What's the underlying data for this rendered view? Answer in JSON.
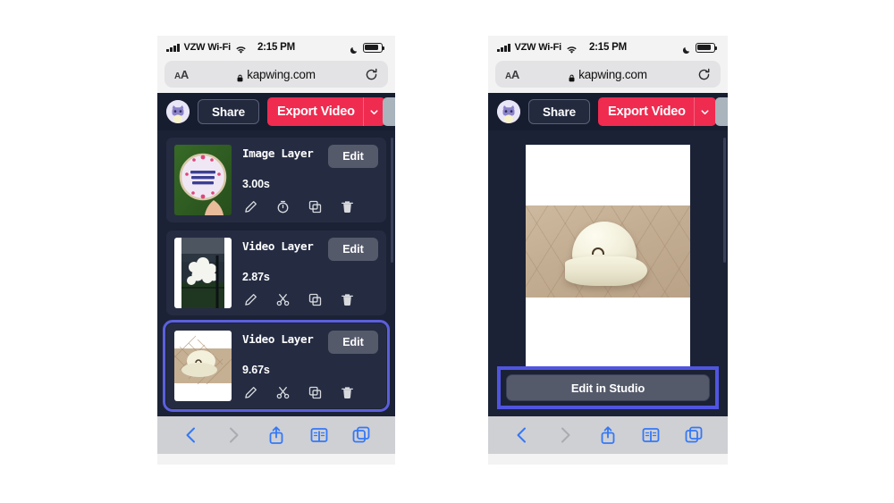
{
  "page": {
    "background": "#ffffff"
  },
  "colors": {
    "app_bg": "#1b2236",
    "card_bg": "#252c42",
    "toolbar_bg": "#161d2f",
    "export_red": "#ef2b50",
    "selection_blue": "#5b5fdc",
    "highlight_blue": "#5055e0",
    "button_grey": "#555a6b",
    "safari_chrome": "#f3f3f3",
    "safari_bottom": "#cfd0d4",
    "ios_blue": "#3478f6"
  },
  "status_bar": {
    "carrier": "VZW Wi-Fi",
    "time": "2:15 PM",
    "signal_icon": "cellular-signal-icon",
    "wifi_icon": "wifi-icon",
    "moon_icon": "do-not-disturb-moon-icon",
    "battery_icon": "battery-icon",
    "battery_level": "86%"
  },
  "browser": {
    "text_size_label": "AA",
    "lock_icon": "lock-icon",
    "url": "kapwing.com",
    "reload_icon": "reload-icon",
    "bottom_bar": [
      {
        "name": "back-button",
        "icon": "chevron-left-icon",
        "enabled": true
      },
      {
        "name": "forward-button",
        "icon": "chevron-right-icon",
        "enabled": false
      },
      {
        "name": "share-button",
        "icon": "share-icon",
        "enabled": true
      },
      {
        "name": "bookmarks-button",
        "icon": "book-icon",
        "enabled": true
      },
      {
        "name": "tabs-button",
        "icon": "tabs-icon",
        "enabled": true
      }
    ]
  },
  "app_toolbar": {
    "avatar_icon": "user-avatar-icon",
    "share_label": "Share",
    "export_label": "Export Video",
    "export_caret_icon": "chevron-down-icon"
  },
  "left_phone": {
    "layers": [
      {
        "title": "Image Layer",
        "duration": "3.00s",
        "edit_label": "Edit",
        "selected": false,
        "thumbnail_alt": "Embroidery hoop reading I Can't Adult today on grass",
        "actions": [
          "pencil-icon",
          "timer-icon",
          "duplicate-icon",
          "trash-icon"
        ]
      },
      {
        "title": "Video Layer",
        "duration": "2.87s",
        "edit_label": "Edit",
        "selected": false,
        "thumbnail_alt": "White flowering bush beside a dark railing",
        "actions": [
          "pencil-icon",
          "scissors-icon",
          "duplicate-icon",
          "trash-icon"
        ]
      },
      {
        "title": "Video Layer",
        "duration": "9.67s",
        "edit_label": "Edit",
        "selected": true,
        "thumbnail_alt": "Cream baseball cap on tan quilted surface",
        "actions": [
          "pencil-icon",
          "scissors-icon",
          "duplicate-icon",
          "trash-icon"
        ]
      }
    ]
  },
  "right_phone": {
    "preview_alt": "Cream baseball cap on tan quilted surface, letterboxed on white canvas",
    "studio_button_label": "Edit in Studio",
    "studio_button_highlighted": true
  }
}
